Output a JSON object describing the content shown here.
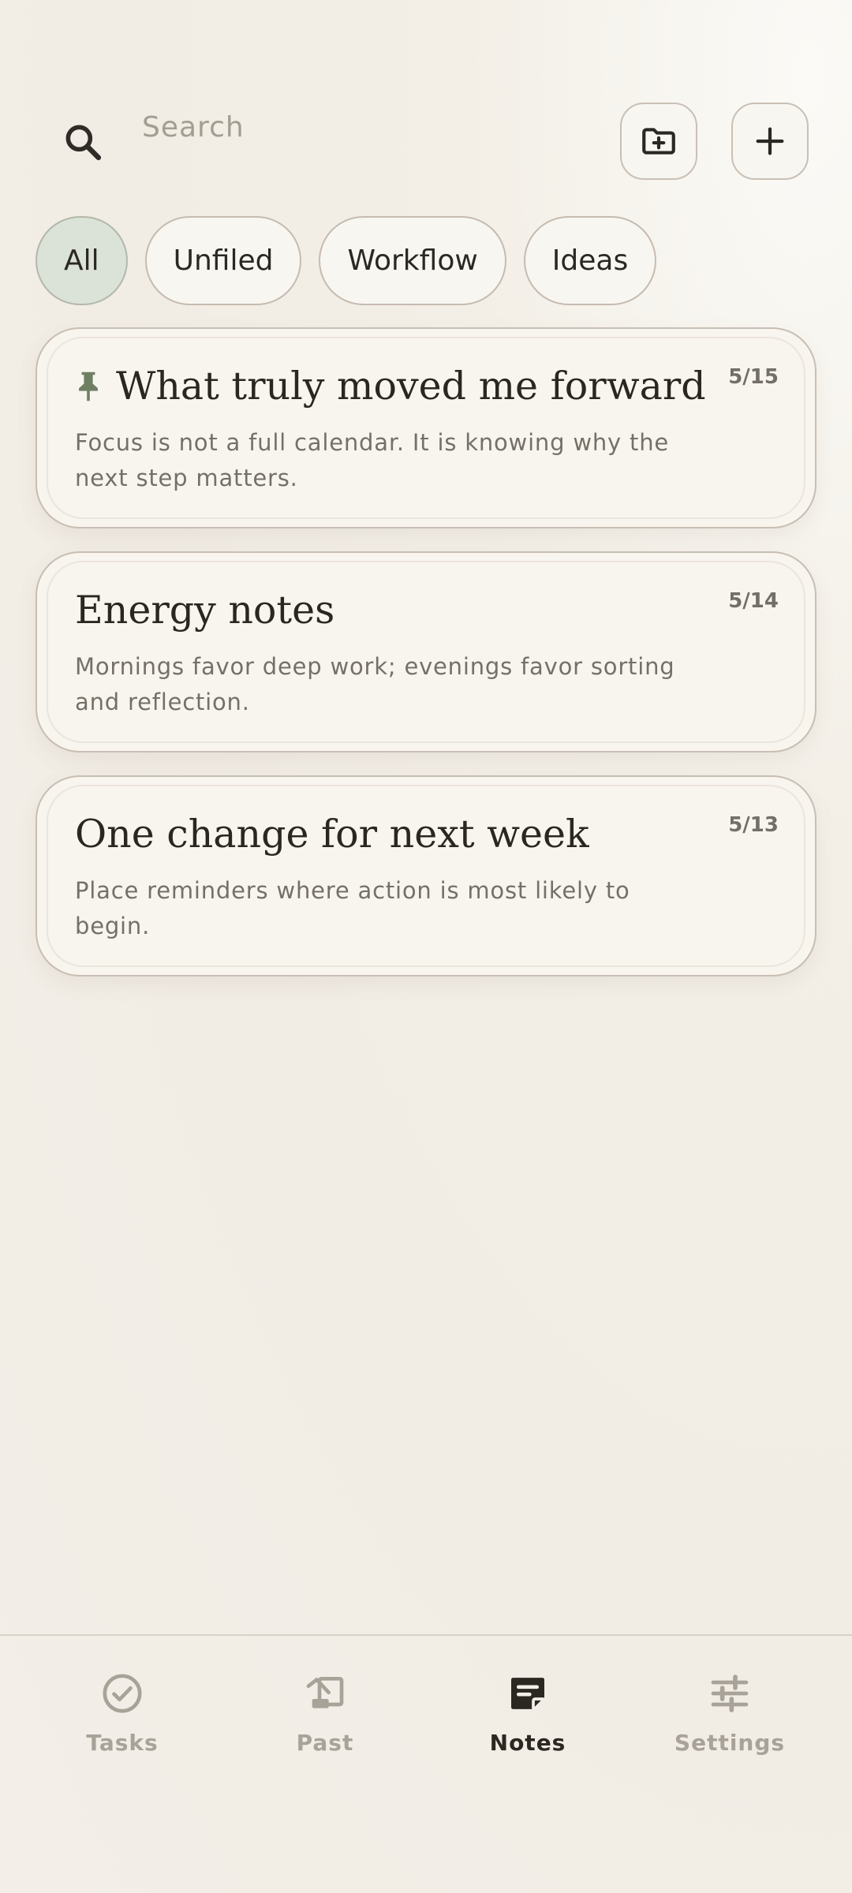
{
  "search": {
    "placeholder": "Search"
  },
  "filters": [
    {
      "label": "All",
      "active": true
    },
    {
      "label": "Unfiled",
      "active": false
    },
    {
      "label": "Workflow",
      "active": false
    },
    {
      "label": "Ideas",
      "active": false
    }
  ],
  "notes": [
    {
      "title": "What truly moved me forward",
      "date": "5/15",
      "body": "Focus is not a full calendar. It is knowing why the next step matters.",
      "pinned": true
    },
    {
      "title": "Energy notes",
      "date": "5/14",
      "body": "Mornings favor deep work; evenings favor sorting and reflection.",
      "pinned": false
    },
    {
      "title": "One change for next week",
      "date": "5/13",
      "body": "Place reminders where action is most likely to begin.",
      "pinned": false
    }
  ],
  "nav": [
    {
      "label": "Tasks",
      "icon": "check-circle-icon",
      "active": false
    },
    {
      "label": "Past",
      "icon": "past-icon",
      "active": false
    },
    {
      "label": "Notes",
      "icon": "notes-icon",
      "active": true
    },
    {
      "label": "Settings",
      "icon": "sliders-icon",
      "active": false
    }
  ],
  "colors": {
    "background": "#f2eee6",
    "card": "#f8f5ef",
    "active_chip": "#dbe2d7",
    "pin": "#6e7f62",
    "text": "#2b2822",
    "muted": "#a8a298"
  }
}
